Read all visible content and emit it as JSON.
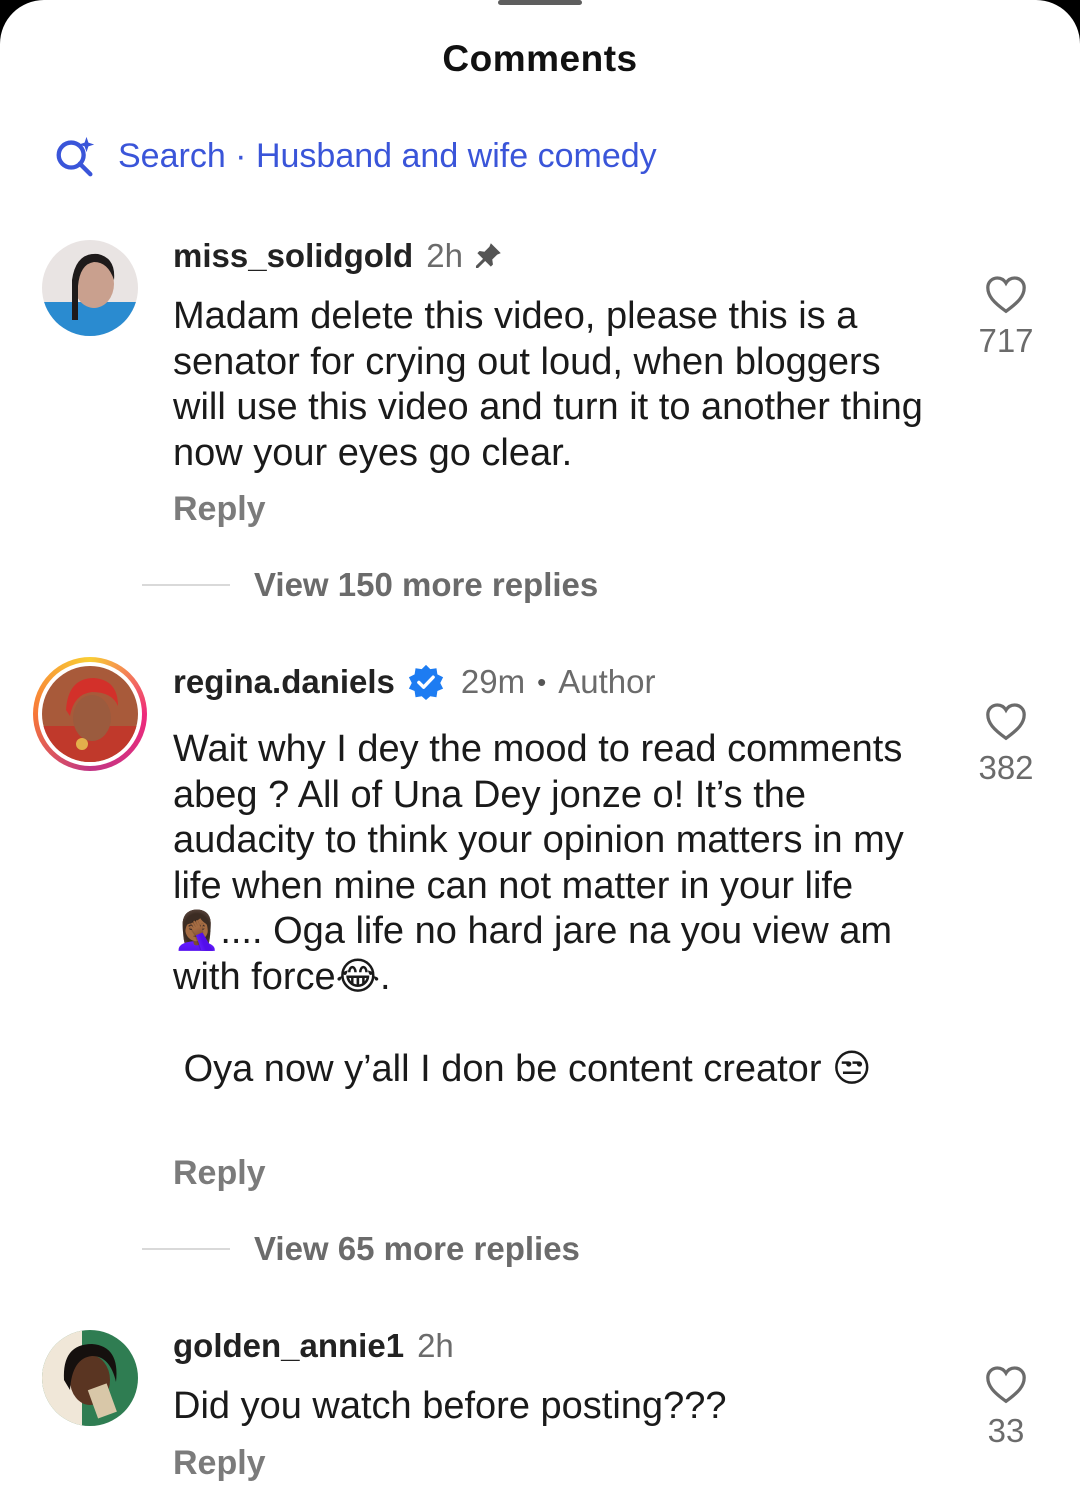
{
  "sheet": {
    "title": "Comments"
  },
  "search": {
    "label": "Search",
    "separator": " · ",
    "query": "Husband and wife comedy"
  },
  "comments": [
    {
      "username": "miss_solidgold",
      "time": "2h",
      "pinned": true,
      "lines": [
        "Madam delete this video, please this is a senator for crying out loud, when bloggers will use this video and turn it to another thing now your eyes go clear."
      ],
      "reply_label": "Reply",
      "likes": "717",
      "more_replies": "View 150 more replies"
    },
    {
      "username": "regina.daniels",
      "verified": true,
      "time": "29m",
      "dot": "•",
      "badge": "Author",
      "lines": [
        "Wait why I dey the mood to read comments abeg ? All of Una Dey jonze o! It’s the audacity to think your opinion matters in my life when mine can not matter in your life 🤦🏾‍♀️.... Oga life no hard jare na you view am with force😂.",
        " Oya now y’all I don be content creator 😒"
      ],
      "reply_label": "Reply",
      "likes": "382",
      "more_replies": "View 65 more replies"
    },
    {
      "username": "golden_annie1",
      "time": "2h",
      "lines": [
        "Did you watch before posting???"
      ],
      "reply_label": "Reply",
      "likes": "33"
    }
  ],
  "colors": {
    "link": "#3a55d9",
    "verified": "#1d7cf2",
    "muted": "#6b6b6b"
  }
}
